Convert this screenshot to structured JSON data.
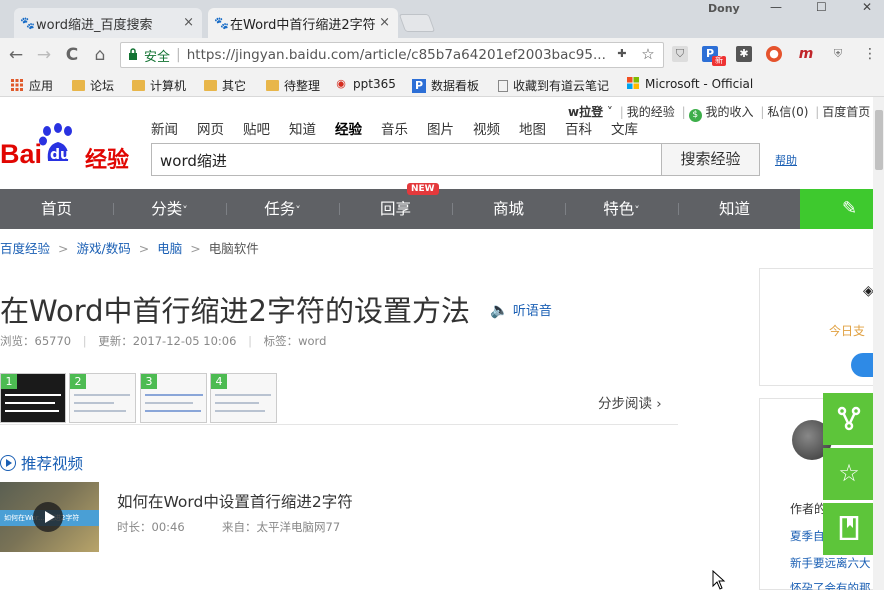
{
  "browser": {
    "profile": "Dony",
    "tabs": [
      {
        "title": "word缩进_百度搜索",
        "close": "×"
      },
      {
        "title": "在Word中首行缩进2字符",
        "close": "×"
      }
    ],
    "window": {
      "minimize": "—",
      "maximize": "☐",
      "close": "✕"
    },
    "toolbar": {
      "back": "←",
      "forward": "→",
      "reload": "C",
      "home": "⌂",
      "lock_icon": "lock-icon",
      "secure_label": "安全",
      "url": "https://jingyan.baidu.com/article/c85b7a64201ef2003bac95..."
    },
    "bookmarks": [
      {
        "label": "应用",
        "icon": "apps-grid-icon"
      },
      {
        "label": "论坛",
        "icon": "folder-icon"
      },
      {
        "label": "计算机",
        "icon": "folder-icon"
      },
      {
        "label": "其它",
        "icon": "folder-icon"
      },
      {
        "label": "待整理",
        "icon": "folder-icon"
      },
      {
        "label": "ppt365",
        "icon": "weibo-icon"
      },
      {
        "label": "数据看板",
        "icon": "p-icon"
      },
      {
        "label": "收藏到有道云笔记",
        "icon": "page-icon"
      },
      {
        "label": "Microsoft - Official",
        "icon": "microsoft-icon"
      }
    ],
    "ext_badge": "新"
  },
  "page": {
    "top_links": {
      "user": "w拉登",
      "my_exp": "我的经验",
      "my_income": "我的收入",
      "messages": "私信(0)",
      "home": "百度首页"
    },
    "channels": [
      "新闻",
      "网页",
      "贴吧",
      "知道",
      "经验",
      "音乐",
      "图片",
      "视频",
      "地图",
      "百科",
      "文库"
    ],
    "active_channel": "经验",
    "logo": {
      "bai": "Bai",
      "du": "du",
      "jingyan": "经验"
    },
    "search": {
      "value": "word缩进",
      "button": "搜索经验",
      "help": "帮助"
    },
    "main_nav": [
      {
        "label": "首页"
      },
      {
        "label": "分类",
        "caret": "˅"
      },
      {
        "label": "任务",
        "caret": "˅"
      },
      {
        "label": "回享"
      },
      {
        "label": "商城"
      },
      {
        "label": "特色",
        "caret": "˅"
      },
      {
        "label": "知道"
      }
    ],
    "new_badge": "NEW",
    "green_icon": "edit-icon",
    "breadcrumb": [
      "百度经验",
      "游戏/数码",
      "电脑",
      "电脑软件"
    ],
    "breadcrumb_arrow": ">",
    "title": "在Word中首行缩进2字符的设置方法",
    "listen": "听语音",
    "meta": {
      "views_label": "浏览：",
      "views": "65770",
      "updated_label": "更新：",
      "updated": "2017-12-05 10:06",
      "tags_label": "标签：",
      "tags": "word"
    },
    "steps": [
      "1",
      "2",
      "3",
      "4"
    ],
    "step_read": "分步阅读 ›",
    "video_section": "推荐视频",
    "video": {
      "title": "如何在Word中设置首行缩进2字符",
      "duration_label": "时长：",
      "duration": "00:46",
      "source_label": "来自：",
      "source": "太平洋电脑网77",
      "thumb_text": "如何在Wor... 缩进2字符"
    },
    "sidebar": {
      "today": "今日支",
      "author": "作者的",
      "links": [
        "夏季自",
        "新手要远离六大",
        "怀孕了会有的那"
      ]
    },
    "float_buttons": [
      "share-icon",
      "star-icon",
      "bookmark-icon"
    ]
  }
}
